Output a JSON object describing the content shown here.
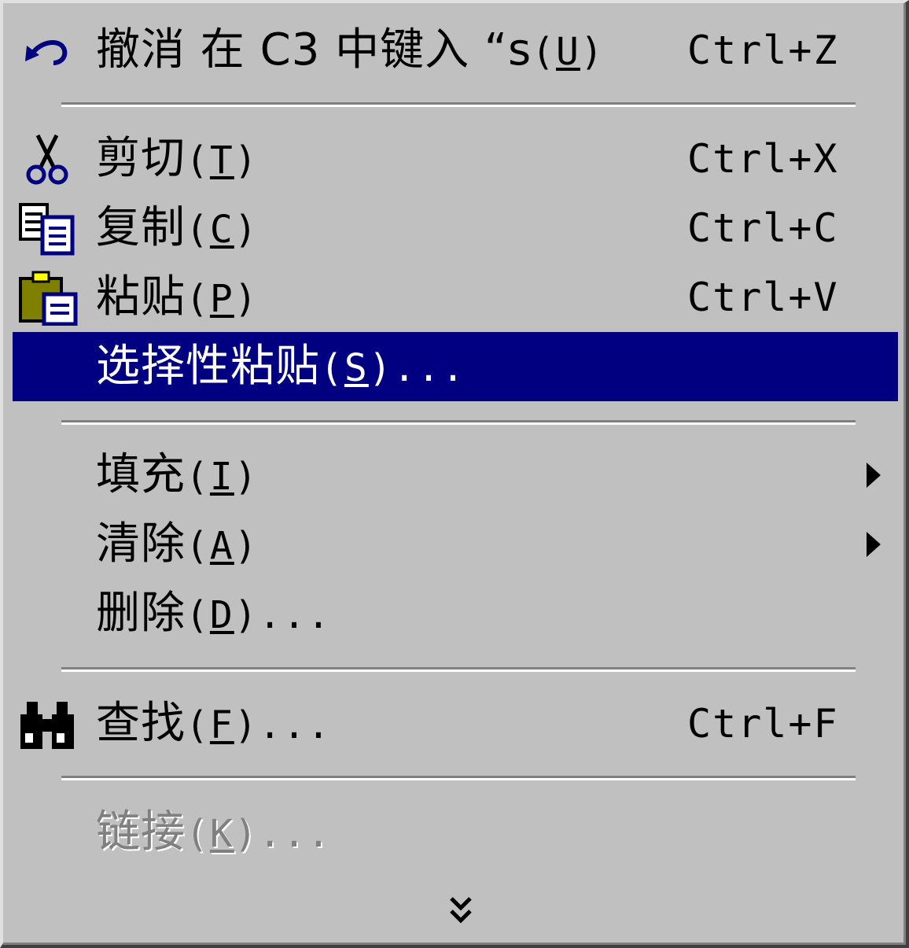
{
  "menu": {
    "undo": {
      "label": "撤消 在 C3 中键入 “s",
      "mnemonic": "U",
      "shortcut": "Ctrl+Z",
      "icon": "undo-icon"
    },
    "cut": {
      "label": "剪切",
      "mnemonic": "T",
      "shortcut": "Ctrl+X",
      "icon": "scissors-icon"
    },
    "copy": {
      "label": "复制",
      "mnemonic": "C",
      "shortcut": "Ctrl+C",
      "icon": "copy-icon"
    },
    "paste": {
      "label": "粘贴",
      "mnemonic": "P",
      "shortcut": "Ctrl+V",
      "icon": "clipboard-paste-icon"
    },
    "paste_special": {
      "label": "选择性粘贴",
      "mnemonic": "S",
      "suffix": "...",
      "highlighted": true
    },
    "fill": {
      "label": "填充",
      "mnemonic": "I",
      "submenu": true
    },
    "clear": {
      "label": "清除",
      "mnemonic": "A",
      "submenu": true
    },
    "delete": {
      "label": "删除",
      "mnemonic": "D",
      "suffix": "..."
    },
    "find": {
      "label": "查找",
      "mnemonic": "F",
      "suffix": "...",
      "shortcut": "Ctrl+F",
      "icon": "binoculars-icon"
    },
    "links": {
      "label": "链接",
      "mnemonic": "K",
      "suffix": "...",
      "disabled": true
    },
    "expand_icon": "double-chevron-down-icon"
  },
  "colors": {
    "menu_bg": "#c0c0c0",
    "highlight_bg": "#000080",
    "highlight_text": "#ffffff",
    "disabled_text": "#808080"
  }
}
